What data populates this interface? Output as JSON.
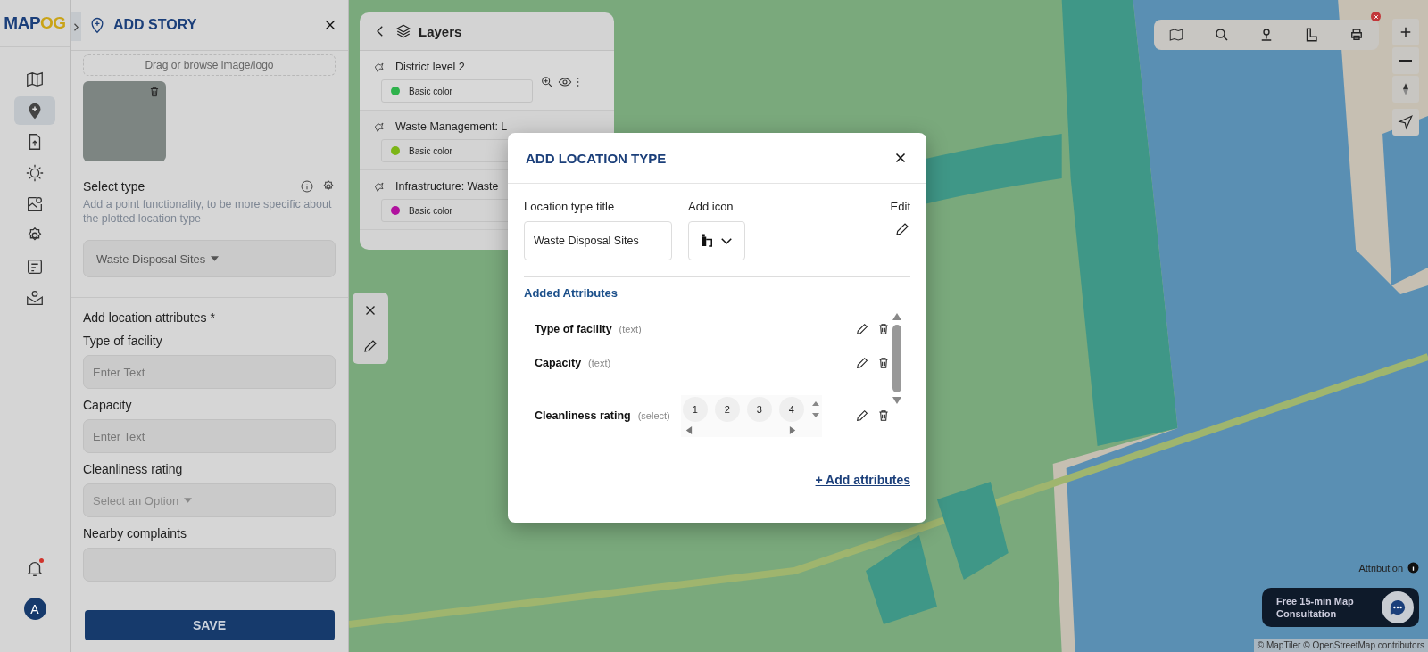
{
  "logo": {
    "part_1": "MAP",
    "part_2": "OG"
  },
  "rail": {
    "items": [
      {
        "kind": "map",
        "selected": false
      },
      {
        "kind": "pin",
        "selected": true
      },
      {
        "kind": "upload",
        "selected": false
      },
      {
        "kind": "burst",
        "selected": false
      },
      {
        "kind": "gallery",
        "selected": false
      },
      {
        "kind": "settings",
        "selected": false
      },
      {
        "kind": "form",
        "selected": false
      },
      {
        "kind": "mail",
        "selected": false
      }
    ],
    "notification_badge": true,
    "avatar": "A"
  },
  "panel": {
    "title": "ADD STORY",
    "upload_hint": "Drag or browse image/logo",
    "select_type": {
      "label": "Select type",
      "help": "Add a point functionality, to be more specific about the plotted location type",
      "value": "Waste Disposal Sites"
    },
    "attributes_heading": "Add location attributes *",
    "fields": [
      {
        "label": "Type of facility",
        "kind": "text",
        "placeholder": "Enter Text"
      },
      {
        "label": "Capacity",
        "kind": "text",
        "placeholder": "Enter Text"
      },
      {
        "label": "Cleanliness rating",
        "kind": "select",
        "placeholder": "Select an Option"
      },
      {
        "label": "Nearby complaints",
        "kind": "text"
      }
    ],
    "save": "SAVE"
  },
  "layers": {
    "title": "Layers",
    "items": [
      {
        "name": "District level 2",
        "color": "#2fb24c",
        "style": "Basic color",
        "hovered": true
      },
      {
        "name": "Waste Management: L",
        "color": "#7cb516",
        "style": "Basic color"
      },
      {
        "name": "Infrastructure: Waste",
        "color": "#b0119e",
        "style": "Basic color"
      }
    ]
  },
  "modal": {
    "title": "ADD LOCATION TYPE",
    "title_label": "Location type title",
    "title_value": "Waste Disposal Sites",
    "icon_label": "Add icon",
    "edit_label": "Edit",
    "attributes_heading": "Added Attributes",
    "attributes": [
      {
        "name": "Type of facility",
        "type": "(text)",
        "kind": "text"
      },
      {
        "name": "Capacity",
        "type": "(text)",
        "kind": "text"
      },
      {
        "name": "Cleanliness rating",
        "type": "(select)",
        "kind": "select",
        "options": [
          "1",
          "2",
          "3",
          "4"
        ]
      }
    ],
    "add_link": "+ Add attributes"
  },
  "map": {
    "attribution": "Attribution",
    "consultation": "Free 15-min Map Consultation",
    "credits": "© MapTiler © OpenStreetMap contributors"
  }
}
